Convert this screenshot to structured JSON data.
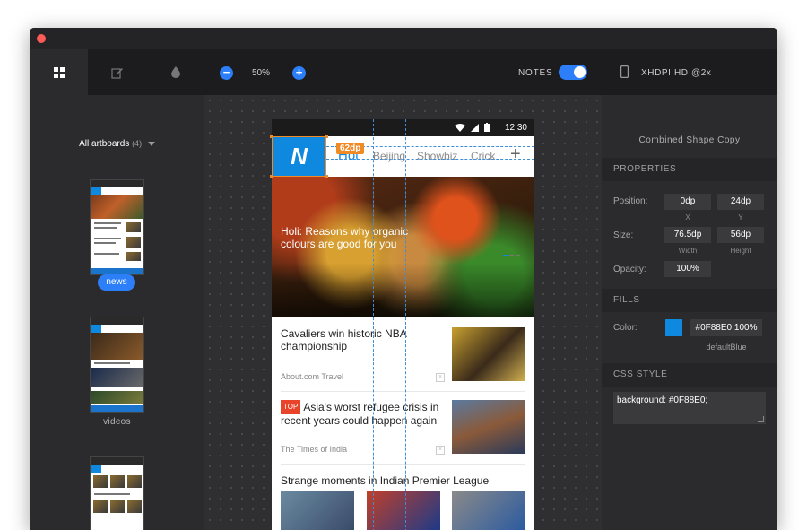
{
  "colors": {
    "accent": "#2d7ff9",
    "brand": "#0f88e0",
    "selection": "#f08a24",
    "guide": "#3d8eda"
  },
  "left_panel": {
    "tabs": [
      {
        "icon": "artboards-grid-icon"
      },
      {
        "icon": "edit-icon"
      },
      {
        "icon": "droplet-icon"
      }
    ],
    "artboards_label": "All artboards",
    "artboards_count": "(4)",
    "artboards": [
      {
        "label": "news",
        "selected": true
      },
      {
        "label": "videos",
        "selected": false
      }
    ]
  },
  "toolbar": {
    "zoom_out": "−",
    "zoom": "50%",
    "zoom_in": "+",
    "notes_label": "NOTES",
    "notes_on": true
  },
  "artboard": {
    "status_time": "12:30",
    "logo": "N",
    "categories": [
      "Hot",
      "Beijing",
      "Showbiz",
      "Crick"
    ],
    "add_label": "+",
    "selection_label": "62dp",
    "hero_title": "Holi: Reasons why organic colours are good for you",
    "articles": [
      {
        "tag": "",
        "title": "Cavaliers win historic NBA championship",
        "source": "About.com Travel"
      },
      {
        "tag": "TOP",
        "title": "Asia's worst refugee crisis in recent years could happen again",
        "source": "The Times of India"
      },
      {
        "tag": "",
        "title": "Strange moments in Indian Premier League",
        "source": ""
      }
    ],
    "close_glyph": "×"
  },
  "right_panel": {
    "device": "XHDPI HD @2x",
    "layer_name": "Combined Shape Copy",
    "properties_header": "PROPERTIES",
    "position_label": "Position:",
    "position_x": "0dp",
    "position_y": "24dp",
    "x_label": "X",
    "y_label": "Y",
    "size_label": "Size:",
    "width": "76.5dp",
    "height": "56dp",
    "width_label": "Width",
    "height_label": "Height",
    "opacity_label": "Opacity:",
    "opacity": "100%",
    "fills_header": "FILLS",
    "color_label": "Color:",
    "color_value": "#0F88E0 100%",
    "color_name": "defaultBlue",
    "css_header": "CSS STYLE",
    "css_code": "background: #0F88E0;"
  }
}
